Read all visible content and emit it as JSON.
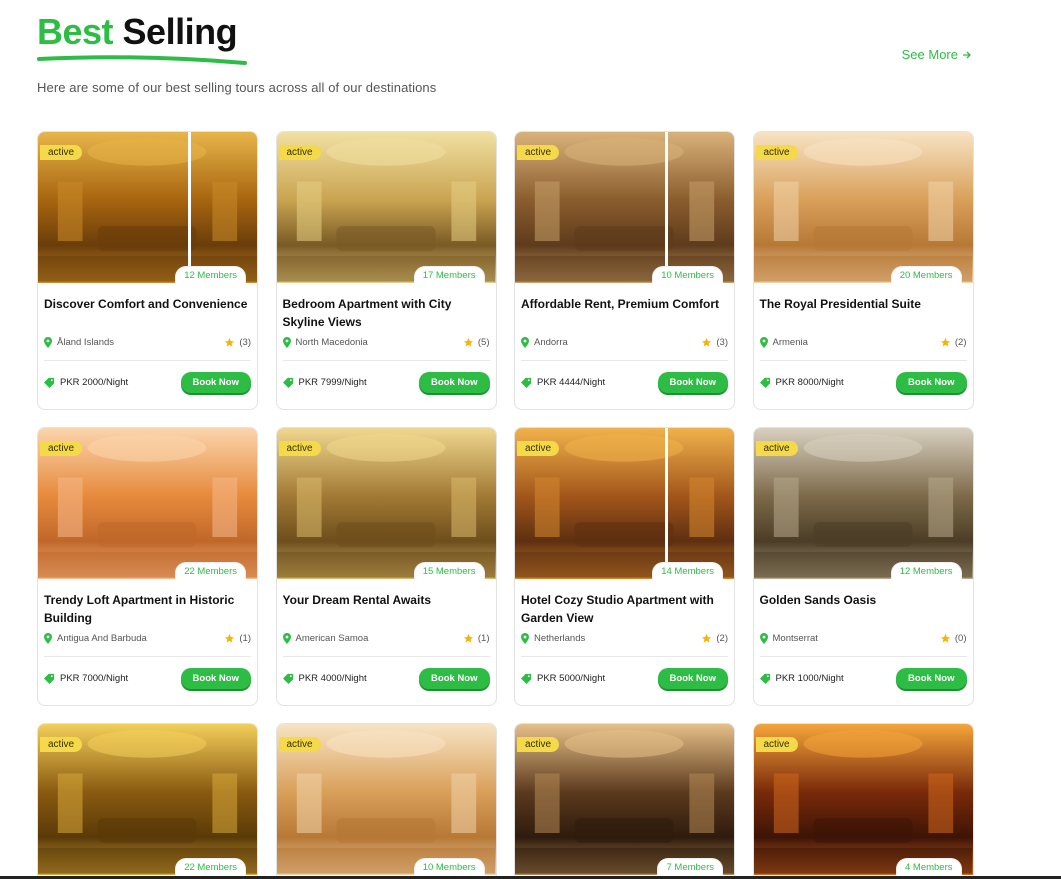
{
  "header": {
    "title_accent": "Best",
    "title_rest": "Selling",
    "subtitle": "Here are some of our best selling tours across all of our destinations",
    "see_more": "See More"
  },
  "colors": {
    "accent": "#2ebd44",
    "badge": "#f4d94a"
  },
  "cards": [
    {
      "badge": "active",
      "members": "12 Members",
      "name": "Discover Comfort and Convenience",
      "location": "Åland Islands",
      "rating": "(3)",
      "price": "PKR 2000/Night",
      "cta": "Book Now"
    },
    {
      "badge": "active",
      "members": "17 Members",
      "name": "Bedroom Apartment with City Skyline Views",
      "location": "North Macedonia",
      "rating": "(5)",
      "price": "PKR 7999/Night",
      "cta": "Book Now"
    },
    {
      "badge": "active",
      "members": "10 Members",
      "name": "Affordable Rent, Premium Comfort",
      "location": "Andorra",
      "rating": "(3)",
      "price": "PKR 4444/Night",
      "cta": "Book Now"
    },
    {
      "badge": "active",
      "members": "20 Members",
      "name": "The Royal Presidential Suite",
      "location": "Armenia",
      "rating": "(2)",
      "price": "PKR 8000/Night",
      "cta": "Book Now"
    },
    {
      "badge": "active",
      "members": "22 Members",
      "name": "Trendy Loft Apartment in Historic Building",
      "location": "Antigua And Barbuda",
      "rating": "(1)",
      "price": "PKR 7000/Night",
      "cta": "Book Now"
    },
    {
      "badge": "active",
      "members": "15 Members",
      "name": "Your Dream Rental Awaits",
      "location": "American Samoa",
      "rating": "(1)",
      "price": "PKR 4000/Night",
      "cta": "Book Now"
    },
    {
      "badge": "active",
      "members": "14 Members",
      "name": "Hotel Cozy Studio Apartment with Garden View",
      "location": "Netherlands",
      "rating": "(2)",
      "price": "PKR 5000/Night",
      "cta": "Book Now"
    },
    {
      "badge": "active",
      "members": "12 Members",
      "name": "Golden Sands Oasis",
      "location": "Montserrat",
      "rating": "(0)",
      "price": "PKR 1000/Night",
      "cta": "Book Now"
    },
    {
      "badge": "active",
      "members": "22 Members"
    },
    {
      "badge": "active",
      "members": "10 Members"
    },
    {
      "badge": "active",
      "members": "7 Members"
    },
    {
      "badge": "active",
      "members": "4 Members"
    }
  ]
}
